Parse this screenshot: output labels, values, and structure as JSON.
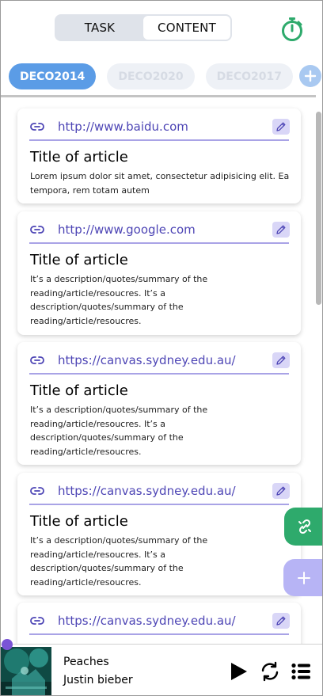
{
  "tabs": [
    {
      "label": "TASK",
      "active": false
    },
    {
      "label": "CONTENT",
      "active": true
    }
  ],
  "courses": [
    {
      "label": "DECO2014",
      "active": true
    },
    {
      "label": "DECO2020",
      "active": false
    },
    {
      "label": "DECO2017",
      "active": false
    }
  ],
  "colors": {
    "accent": "#5b9ce6",
    "link": "#4d45b5",
    "timer": "#2eaa6c",
    "fab_link": "#2eaa6c",
    "fab_add": "#b7b4f5",
    "progress": "#7a54d6"
  },
  "icons": {
    "timer": "stopwatch-icon",
    "link": "link-icon",
    "edit": "pencil-icon",
    "add": "plus-icon",
    "fab_link": "link-icon",
    "play": "play-icon",
    "repeat": "repeat-icon",
    "queue": "list-icon"
  },
  "cards": [
    {
      "url": "http://www.baidu.com",
      "title": "Title of article",
      "desc": "Lorem ipsum dolor sit amet, consectetur adipisicing elit. Ea tempora, rem totam autem"
    },
    {
      "url": "http://www.google.com",
      "title": "Title of article",
      "desc": "It’s a description/quotes/summary of the reading/article/resoucres. It’s a description/quotes/summary of the reading/article/resoucres."
    },
    {
      "url": "https://canvas.sydney.edu.au/",
      "title": "Title of article",
      "desc": "It’s a description/quotes/summary of the reading/article/resoucres. It’s a description/quotes/summary of the reading/article/resoucres."
    },
    {
      "url": "https://canvas.sydney.edu.au/",
      "title": "Title of article",
      "desc": "It’s a description/quotes/summary of the reading/article/resoucres. It’s a description/quotes/summary of the reading/article/resoucres."
    },
    {
      "url": "https://canvas.sydney.edu.au/",
      "title": "",
      "desc": ""
    }
  ],
  "player": {
    "song": "Peaches",
    "artist": "Justin bieber",
    "progress": 0
  }
}
